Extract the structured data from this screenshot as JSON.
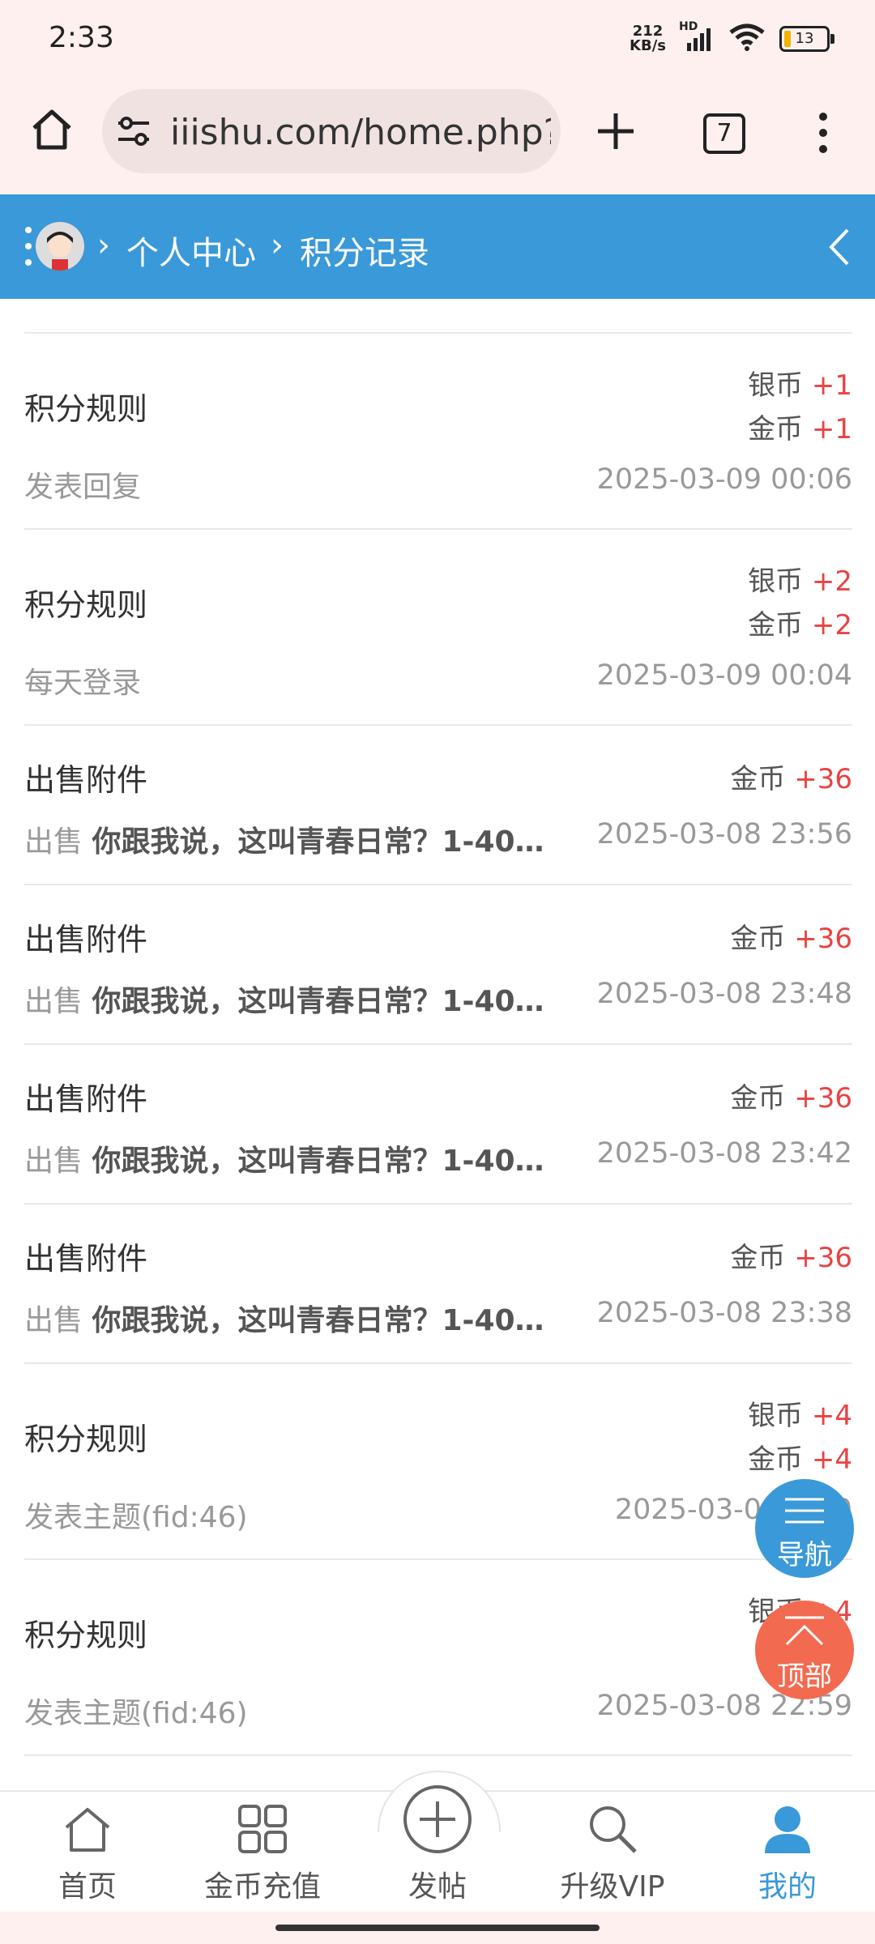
{
  "status_bar": {
    "time": "2:33",
    "net_speed_value": "212",
    "net_speed_unit": "KB/s",
    "hd": "HD",
    "battery": "13"
  },
  "browser": {
    "url": "iiishu.com/home.php?mod=spacecp&ac=credit&op=log",
    "tab_count": "7"
  },
  "header": {
    "breadcrumb": [
      "个人中心",
      "积分记录"
    ],
    "separator": "›"
  },
  "records": [
    {
      "title": "积分规则",
      "desc": "发表回复",
      "date": "2025-03-09 00:06",
      "credits": [
        {
          "name": "银币",
          "amount": "+1"
        },
        {
          "name": "金币",
          "amount": "+1"
        }
      ]
    },
    {
      "title": "积分规则",
      "desc": "每天登录",
      "date": "2025-03-09 00:04",
      "credits": [
        {
          "name": "银币",
          "amount": "+2"
        },
        {
          "name": "金币",
          "amount": "+2"
        }
      ]
    },
    {
      "title": "出售附件",
      "desc_prefix": "出售",
      "desc_bold": "你跟我说，这叫青春日常？1-40…",
      "date": "2025-03-08 23:56",
      "credits": [
        {
          "name": "金币",
          "amount": "+36"
        }
      ]
    },
    {
      "title": "出售附件",
      "desc_prefix": "出售",
      "desc_bold": "你跟我说，这叫青春日常？1-40…",
      "date": "2025-03-08 23:48",
      "credits": [
        {
          "name": "金币",
          "amount": "+36"
        }
      ]
    },
    {
      "title": "出售附件",
      "desc_prefix": "出售",
      "desc_bold": "你跟我说，这叫青春日常？1-40…",
      "date": "2025-03-08 23:42",
      "credits": [
        {
          "name": "金币",
          "amount": "+36"
        }
      ]
    },
    {
      "title": "出售附件",
      "desc_prefix": "出售",
      "desc_bold": "你跟我说，这叫青春日常？1-40…",
      "date": "2025-03-08 23:38",
      "credits": [
        {
          "name": "金币",
          "amount": "+36"
        }
      ]
    },
    {
      "title": "积分规则",
      "desc": "发表主题(fid:46)",
      "date": "2025-03-08 23:0",
      "credits": [
        {
          "name": "银币",
          "amount": "+4"
        },
        {
          "name": "金币",
          "amount": "+4"
        }
      ]
    },
    {
      "title": "积分规则",
      "desc": "发表主题(fid:46)",
      "date": "2025-03-08 22:59",
      "credits": [
        {
          "name": "银币",
          "amount": "+4"
        }
      ]
    }
  ],
  "floating": {
    "nav": "导航",
    "top": "顶部"
  },
  "bottom_nav": [
    {
      "label": "首页",
      "icon": "home-icon"
    },
    {
      "label": "金币充值",
      "icon": "grid-icon"
    },
    {
      "label": "发帖",
      "icon": "plus-circle-icon"
    },
    {
      "label": "升级VIP",
      "icon": "search-icon"
    },
    {
      "label": "我的",
      "icon": "user-icon",
      "active": true
    }
  ],
  "colors": {
    "header": "#3a99d8",
    "amount": "#e84343",
    "nav_fab": "#3a99d8",
    "top_fab": "#f26a50",
    "active_nav": "#3a99d8"
  }
}
